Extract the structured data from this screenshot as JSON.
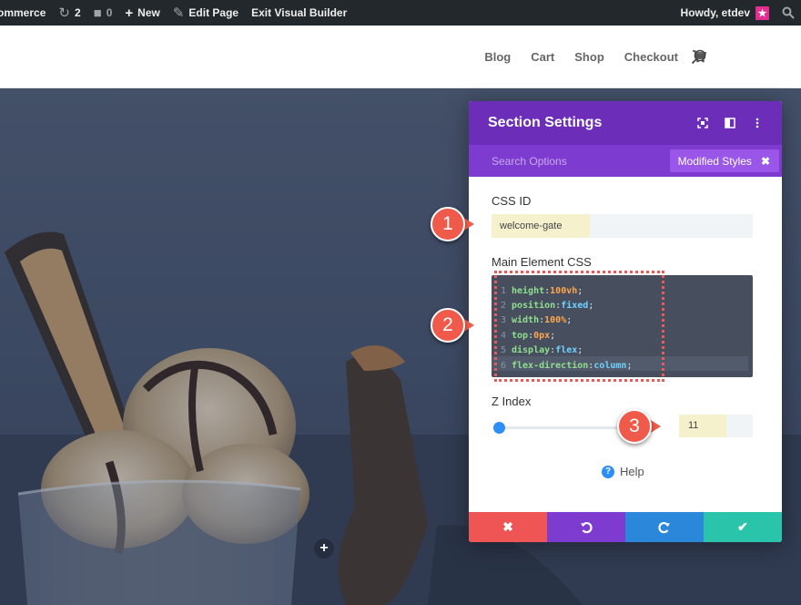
{
  "adminbar": {
    "site_name": "ommerce",
    "updates_count": "2",
    "comments_count": "0",
    "new_label": "New",
    "edit_page_label": "Edit Page",
    "exit_builder_label": "Exit Visual Builder",
    "howdy_label": "Howdy, etdev"
  },
  "nav": {
    "items": [
      "Blog",
      "Cart",
      "Shop",
      "Checkout"
    ]
  },
  "modal": {
    "title": "Section Settings",
    "search_placeholder": "Search Options",
    "modified_styles_label": "Modified Styles",
    "css_id_label": "CSS ID",
    "css_id_value": "welcome-gate",
    "main_css_label": "Main Element CSS",
    "code_lines": [
      {
        "num": "1",
        "prop": "height",
        "sep": ": ",
        "value": "100vh",
        "kind": "num"
      },
      {
        "num": "2",
        "prop": "position",
        "sep": ":",
        "value": "fixed",
        "kind": "kw"
      },
      {
        "num": "3",
        "prop": "width",
        "sep": ": ",
        "value": "100%",
        "kind": "num"
      },
      {
        "num": "4",
        "prop": "top",
        "sep": ": ",
        "value": "0px",
        "kind": "num"
      },
      {
        "num": "5",
        "prop": "display",
        "sep": ":",
        "value": "flex",
        "kind": "kw"
      },
      {
        "num": "6",
        "prop": "flex-direction",
        "sep": ": ",
        "value": "column",
        "kind": "kw"
      }
    ],
    "z_index_label": "Z Index",
    "z_index_value": "11",
    "help_label": "Help"
  },
  "callouts": [
    "1",
    "2",
    "3"
  ],
  "colors": {
    "purple_header": "#6c2eb9",
    "purple_bar": "#7e3bd0",
    "cancel": "#ef5555",
    "redo": "#2b87da",
    "save": "#29c4a9",
    "callout": "#ef5a4a"
  }
}
